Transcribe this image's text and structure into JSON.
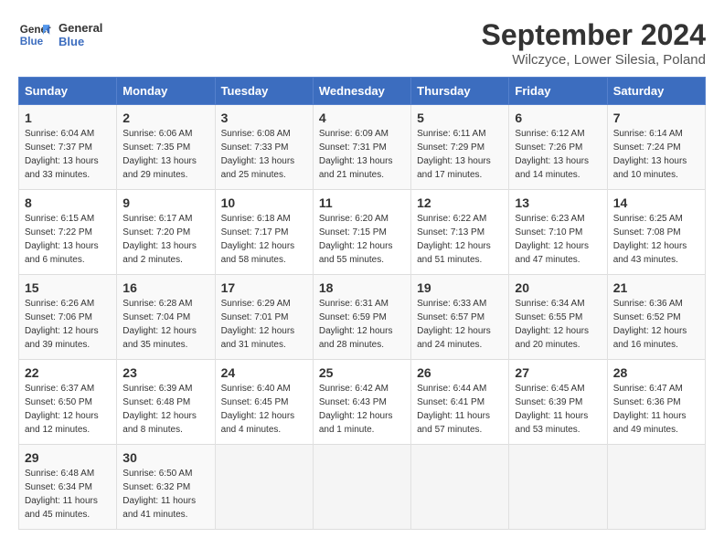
{
  "header": {
    "logo_line1": "General",
    "logo_line2": "Blue",
    "month": "September 2024",
    "location": "Wilczyce, Lower Silesia, Poland"
  },
  "weekdays": [
    "Sunday",
    "Monday",
    "Tuesday",
    "Wednesday",
    "Thursday",
    "Friday",
    "Saturday"
  ],
  "weeks": [
    [
      {
        "day": "1",
        "sunrise": "Sunrise: 6:04 AM",
        "sunset": "Sunset: 7:37 PM",
        "daylight": "Daylight: 13 hours and 33 minutes."
      },
      {
        "day": "2",
        "sunrise": "Sunrise: 6:06 AM",
        "sunset": "Sunset: 7:35 PM",
        "daylight": "Daylight: 13 hours and 29 minutes."
      },
      {
        "day": "3",
        "sunrise": "Sunrise: 6:08 AM",
        "sunset": "Sunset: 7:33 PM",
        "daylight": "Daylight: 13 hours and 25 minutes."
      },
      {
        "day": "4",
        "sunrise": "Sunrise: 6:09 AM",
        "sunset": "Sunset: 7:31 PM",
        "daylight": "Daylight: 13 hours and 21 minutes."
      },
      {
        "day": "5",
        "sunrise": "Sunrise: 6:11 AM",
        "sunset": "Sunset: 7:29 PM",
        "daylight": "Daylight: 13 hours and 17 minutes."
      },
      {
        "day": "6",
        "sunrise": "Sunrise: 6:12 AM",
        "sunset": "Sunset: 7:26 PM",
        "daylight": "Daylight: 13 hours and 14 minutes."
      },
      {
        "day": "7",
        "sunrise": "Sunrise: 6:14 AM",
        "sunset": "Sunset: 7:24 PM",
        "daylight": "Daylight: 13 hours and 10 minutes."
      }
    ],
    [
      {
        "day": "8",
        "sunrise": "Sunrise: 6:15 AM",
        "sunset": "Sunset: 7:22 PM",
        "daylight": "Daylight: 13 hours and 6 minutes."
      },
      {
        "day": "9",
        "sunrise": "Sunrise: 6:17 AM",
        "sunset": "Sunset: 7:20 PM",
        "daylight": "Daylight: 13 hours and 2 minutes."
      },
      {
        "day": "10",
        "sunrise": "Sunrise: 6:18 AM",
        "sunset": "Sunset: 7:17 PM",
        "daylight": "Daylight: 12 hours and 58 minutes."
      },
      {
        "day": "11",
        "sunrise": "Sunrise: 6:20 AM",
        "sunset": "Sunset: 7:15 PM",
        "daylight": "Daylight: 12 hours and 55 minutes."
      },
      {
        "day": "12",
        "sunrise": "Sunrise: 6:22 AM",
        "sunset": "Sunset: 7:13 PM",
        "daylight": "Daylight: 12 hours and 51 minutes."
      },
      {
        "day": "13",
        "sunrise": "Sunrise: 6:23 AM",
        "sunset": "Sunset: 7:10 PM",
        "daylight": "Daylight: 12 hours and 47 minutes."
      },
      {
        "day": "14",
        "sunrise": "Sunrise: 6:25 AM",
        "sunset": "Sunset: 7:08 PM",
        "daylight": "Daylight: 12 hours and 43 minutes."
      }
    ],
    [
      {
        "day": "15",
        "sunrise": "Sunrise: 6:26 AM",
        "sunset": "Sunset: 7:06 PM",
        "daylight": "Daylight: 12 hours and 39 minutes."
      },
      {
        "day": "16",
        "sunrise": "Sunrise: 6:28 AM",
        "sunset": "Sunset: 7:04 PM",
        "daylight": "Daylight: 12 hours and 35 minutes."
      },
      {
        "day": "17",
        "sunrise": "Sunrise: 6:29 AM",
        "sunset": "Sunset: 7:01 PM",
        "daylight": "Daylight: 12 hours and 31 minutes."
      },
      {
        "day": "18",
        "sunrise": "Sunrise: 6:31 AM",
        "sunset": "Sunset: 6:59 PM",
        "daylight": "Daylight: 12 hours and 28 minutes."
      },
      {
        "day": "19",
        "sunrise": "Sunrise: 6:33 AM",
        "sunset": "Sunset: 6:57 PM",
        "daylight": "Daylight: 12 hours and 24 minutes."
      },
      {
        "day": "20",
        "sunrise": "Sunrise: 6:34 AM",
        "sunset": "Sunset: 6:55 PM",
        "daylight": "Daylight: 12 hours and 20 minutes."
      },
      {
        "day": "21",
        "sunrise": "Sunrise: 6:36 AM",
        "sunset": "Sunset: 6:52 PM",
        "daylight": "Daylight: 12 hours and 16 minutes."
      }
    ],
    [
      {
        "day": "22",
        "sunrise": "Sunrise: 6:37 AM",
        "sunset": "Sunset: 6:50 PM",
        "daylight": "Daylight: 12 hours and 12 minutes."
      },
      {
        "day": "23",
        "sunrise": "Sunrise: 6:39 AM",
        "sunset": "Sunset: 6:48 PM",
        "daylight": "Daylight: 12 hours and 8 minutes."
      },
      {
        "day": "24",
        "sunrise": "Sunrise: 6:40 AM",
        "sunset": "Sunset: 6:45 PM",
        "daylight": "Daylight: 12 hours and 4 minutes."
      },
      {
        "day": "25",
        "sunrise": "Sunrise: 6:42 AM",
        "sunset": "Sunset: 6:43 PM",
        "daylight": "Daylight: 12 hours and 1 minute."
      },
      {
        "day": "26",
        "sunrise": "Sunrise: 6:44 AM",
        "sunset": "Sunset: 6:41 PM",
        "daylight": "Daylight: 11 hours and 57 minutes."
      },
      {
        "day": "27",
        "sunrise": "Sunrise: 6:45 AM",
        "sunset": "Sunset: 6:39 PM",
        "daylight": "Daylight: 11 hours and 53 minutes."
      },
      {
        "day": "28",
        "sunrise": "Sunrise: 6:47 AM",
        "sunset": "Sunset: 6:36 PM",
        "daylight": "Daylight: 11 hours and 49 minutes."
      }
    ],
    [
      {
        "day": "29",
        "sunrise": "Sunrise: 6:48 AM",
        "sunset": "Sunset: 6:34 PM",
        "daylight": "Daylight: 11 hours and 45 minutes."
      },
      {
        "day": "30",
        "sunrise": "Sunrise: 6:50 AM",
        "sunset": "Sunset: 6:32 PM",
        "daylight": "Daylight: 11 hours and 41 minutes."
      },
      null,
      null,
      null,
      null,
      null
    ]
  ]
}
